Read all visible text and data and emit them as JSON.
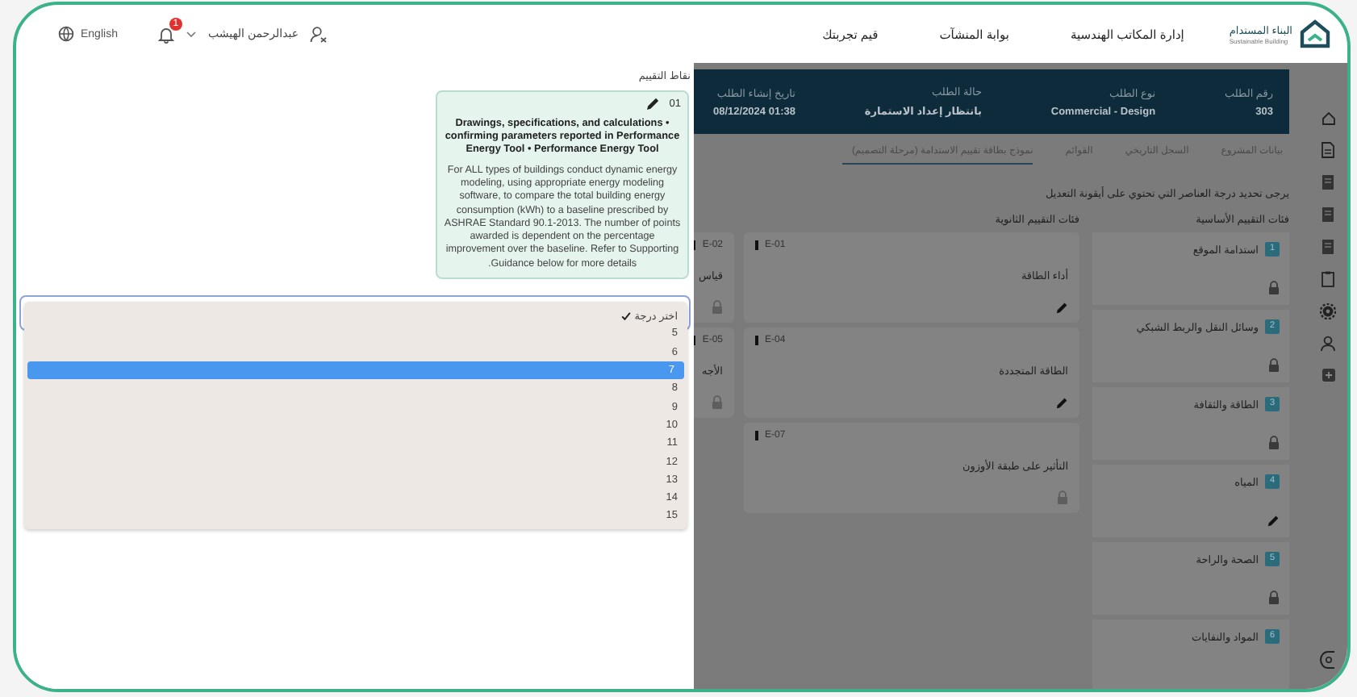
{
  "header": {
    "logo_title": "البناء المستدام",
    "logo_subtitle": "Sustainable Building",
    "nav": [
      "إدارة المكاتب الهندسية",
      "بوابة المنشآت",
      "قيم تجربتك"
    ],
    "user_name": "عبدالرحمن الهيشب",
    "notification_count": "1",
    "language": "English"
  },
  "drawer": {
    "title": "نقاط التقييم",
    "criterion": {
      "number": "01",
      "title": "Drawings, specifications, and calculations • confirming parameters reported in Performance Energy Tool • Performance Energy Tool",
      "description": "For ALL types of buildings conduct dynamic energy modeling, using appropriate energy modeling software, to compare the total building energy consumption (kWh) to a baseline prescribed by ASHRAE Standard 90.1-2013. The number of points awarded is dependent on the percentage improvement over the baseline. Refer to Supporting Guidance below for more details."
    },
    "options": [
      {
        "label": "اختر درجة",
        "checked": true,
        "selected": false
      },
      {
        "label": "5",
        "checked": false,
        "selected": false
      },
      {
        "label": "6",
        "checked": false,
        "selected": false
      },
      {
        "label": "7",
        "checked": false,
        "selected": true
      },
      {
        "label": "8",
        "checked": false,
        "selected": false
      },
      {
        "label": "9",
        "checked": false,
        "selected": false
      },
      {
        "label": "10",
        "checked": false,
        "selected": false
      },
      {
        "label": "11",
        "checked": false,
        "selected": false
      },
      {
        "label": "12",
        "checked": false,
        "selected": false
      },
      {
        "label": "13",
        "checked": false,
        "selected": false
      },
      {
        "label": "14",
        "checked": false,
        "selected": false
      },
      {
        "label": "15",
        "checked": false,
        "selected": false
      }
    ]
  },
  "request": [
    {
      "label": "رقم الطلب",
      "value": "303"
    },
    {
      "label": "نوع الطلب",
      "value": "Commercial - Design"
    },
    {
      "label": "حالة الطلب",
      "value": "بانتظار إعداد الاستمارة"
    },
    {
      "label": "تاريخ إنشاء الطلب",
      "value": "01:38 08/12/2024"
    }
  ],
  "tabs": [
    {
      "label": "بيانات المشروع",
      "selected": false
    },
    {
      "label": "السجل التاريخي",
      "selected": false
    },
    {
      "label": "القوائم",
      "selected": false
    },
    {
      "label": "نموذج بطاقة تقييم الاستدامة (مرحلة التصميم)",
      "selected": true
    }
  ],
  "instruction": "يرجى تحديد درجة العناصر التي تحتوي على أيقونة التعديل",
  "primary_heading": "فئات التقييم الأساسية",
  "secondary_heading": "فئات التقييم الثانوية",
  "primary_categories": [
    {
      "number": "1",
      "name": "استدامة الموقع",
      "kind": "locked"
    },
    {
      "number": "2",
      "name": "وسائل النقل والربط الشبكي",
      "kind": "locked"
    },
    {
      "number": "3",
      "name": "الطاقة والثقافة",
      "kind": "locked"
    },
    {
      "number": "4",
      "name": "المياه",
      "kind": "editable"
    },
    {
      "number": "5",
      "name": "الصحة والراحة",
      "kind": "locked"
    },
    {
      "number": "6",
      "name": "المواد والنفايات"
    }
  ],
  "secondary_categories": [
    {
      "code": "E-01",
      "name": "أداء الطاقة",
      "kind": "editable"
    },
    {
      "code": "E-02",
      "name": "قياس",
      "kind": "locked"
    },
    {
      "code": "E-04",
      "name": "الطاقة المتجددة",
      "kind": "editable"
    },
    {
      "code": "E-05",
      "name": "الأجه",
      "kind": "locked"
    },
    {
      "code": "E-07",
      "name": "التأثير على طبقة الأوزون",
      "kind": "locked"
    }
  ]
}
